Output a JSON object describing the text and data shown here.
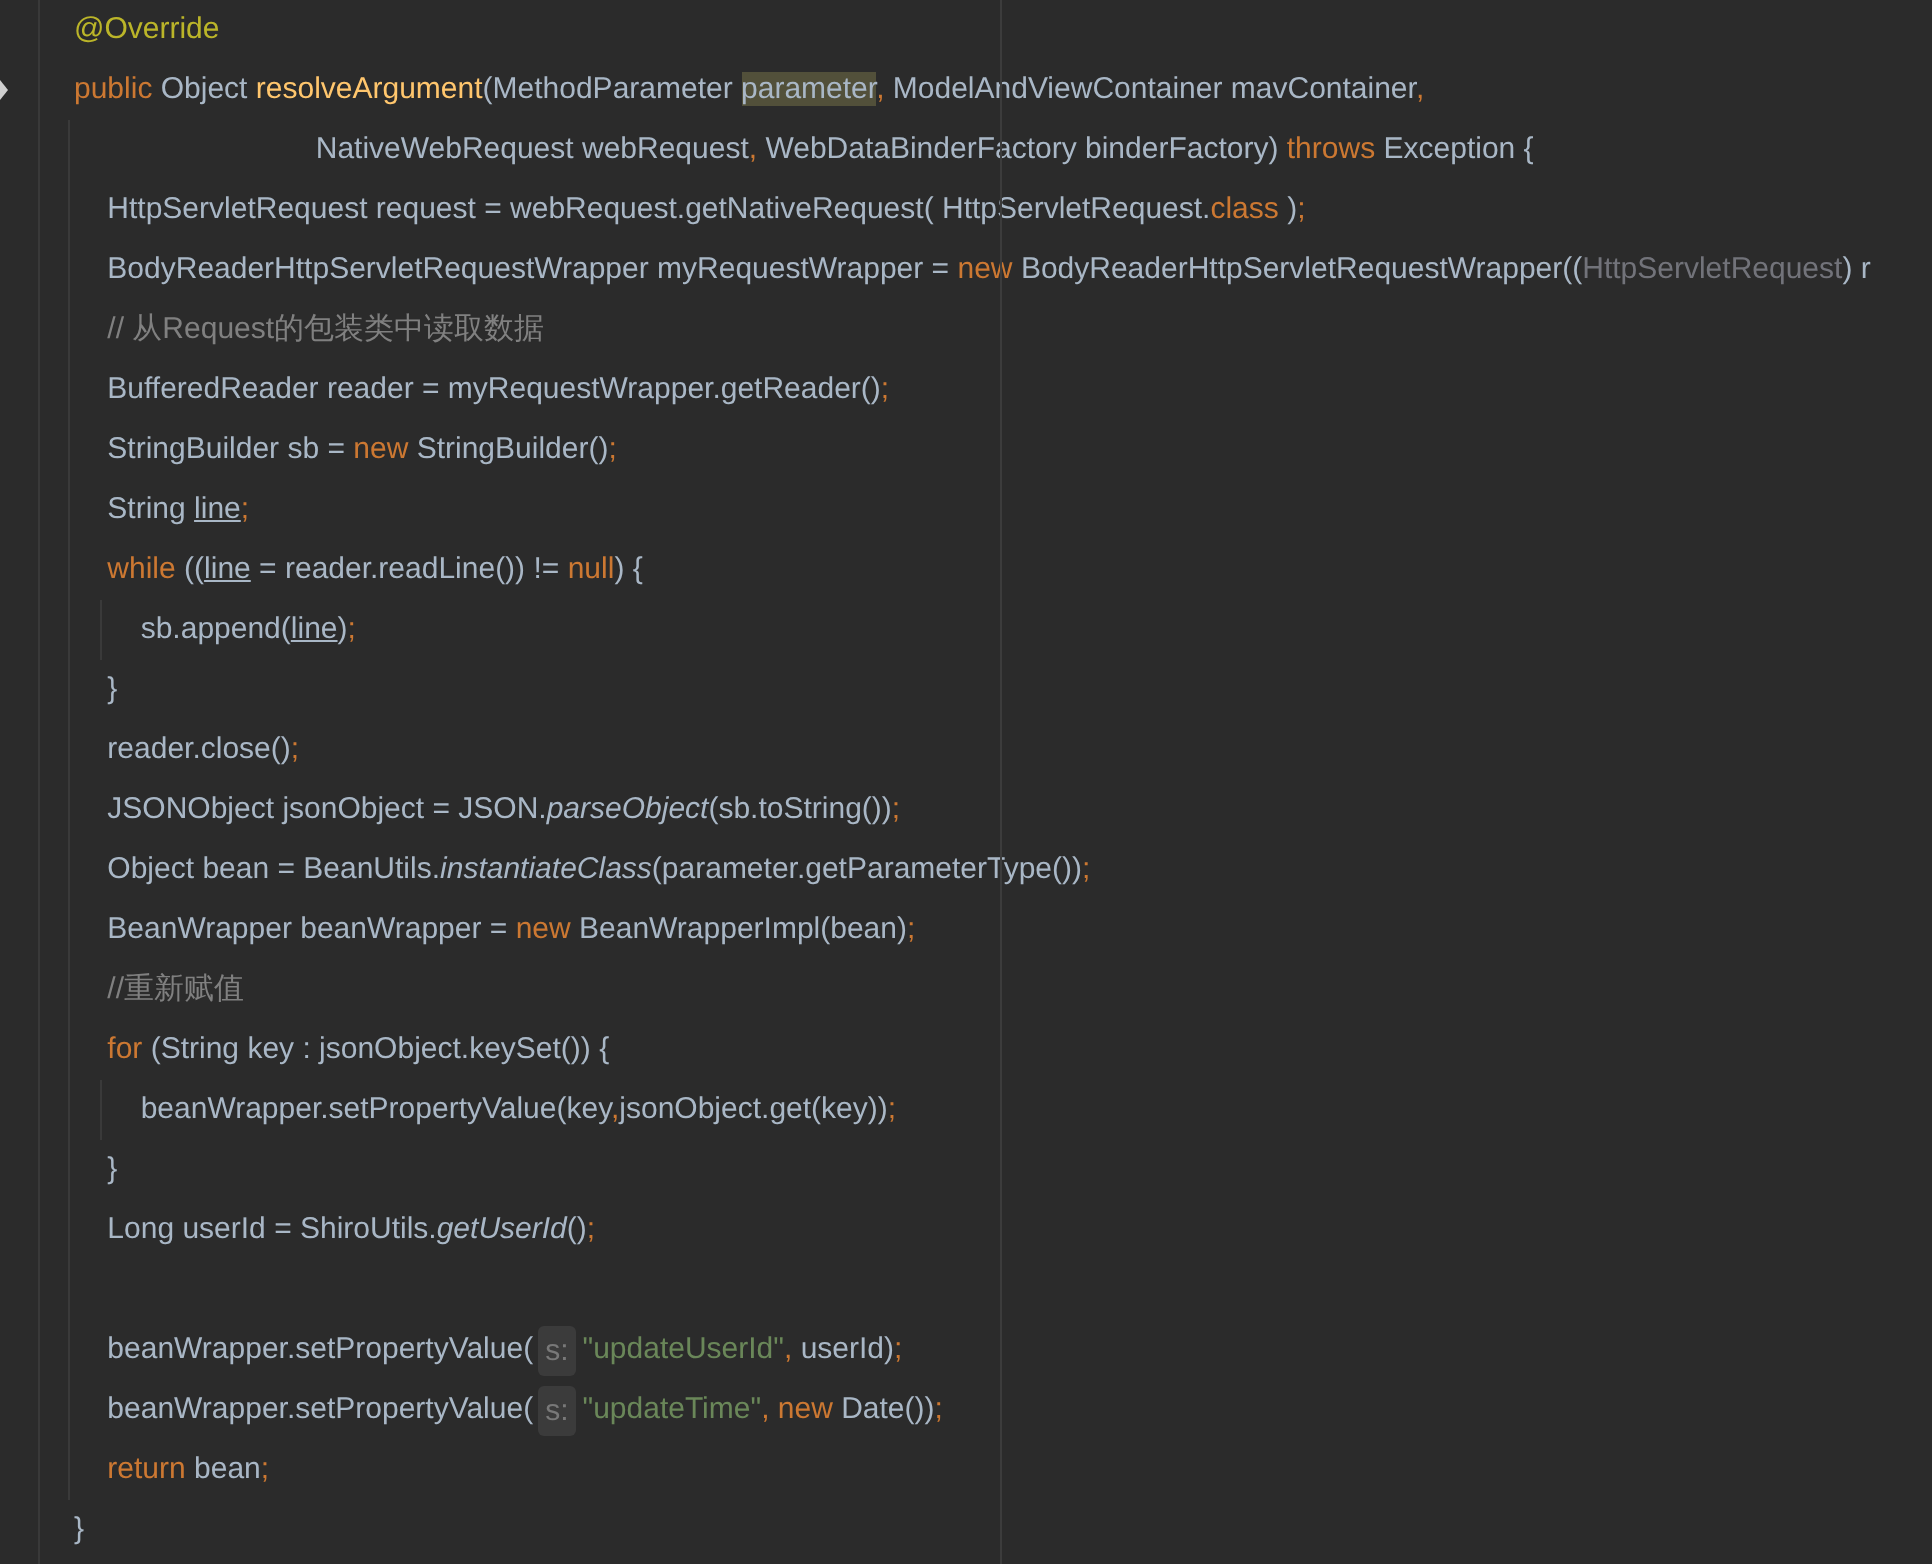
{
  "editor": {
    "lines": [
      [
        {
          "kind": "annotation",
          "text": "@Override"
        }
      ],
      [
        {
          "kind": "keyword",
          "text": "public "
        },
        {
          "kind": "plain",
          "text": "Object "
        },
        {
          "kind": "declaration",
          "text": "resolveArgument"
        },
        {
          "kind": "plain",
          "text": "(MethodParameter "
        },
        {
          "kind": "usage",
          "text": "parameter"
        },
        {
          "kind": "keyword",
          "text": ", "
        },
        {
          "kind": "plain",
          "text": "ModelAndViewContainer mavContainer"
        },
        {
          "kind": "keyword",
          "text": ","
        }
      ],
      [
        {
          "kind": "plain",
          "text": "                             NativeWebRequest webRequest"
        },
        {
          "kind": "keyword",
          "text": ", "
        },
        {
          "kind": "plain",
          "text": "WebDataBinderFactory binderFactory) "
        },
        {
          "kind": "keyword",
          "text": "throws "
        },
        {
          "kind": "plain",
          "text": "Exception {"
        }
      ],
      [
        {
          "kind": "plain",
          "text": "    HttpServletRequest request = webRequest.getNativeRequest( HttpServletRequest."
        },
        {
          "kind": "keyword",
          "text": "class "
        },
        {
          "kind": "plain",
          "text": ")"
        },
        {
          "kind": "keyword",
          "text": ";"
        }
      ],
      [
        {
          "kind": "plain",
          "text": "    BodyReaderHttpServletRequestWrapper myRequestWrapper = "
        },
        {
          "kind": "keyword",
          "text": "new "
        },
        {
          "kind": "plain",
          "text": "BodyReaderHttpServletRequestWrapper(("
        },
        {
          "kind": "unused",
          "text": "HttpServletRequest"
        },
        {
          "kind": "plain",
          "text": ") r"
        }
      ],
      [
        {
          "kind": "comment",
          "text": "    // 从Request的包装类中读取数据"
        }
      ],
      [
        {
          "kind": "plain",
          "text": "    BufferedReader reader = myRequestWrapper.getReader()"
        },
        {
          "kind": "keyword",
          "text": ";"
        }
      ],
      [
        {
          "kind": "plain",
          "text": "    StringBuilder sb = "
        },
        {
          "kind": "keyword",
          "text": "new "
        },
        {
          "kind": "plain",
          "text": "StringBuilder()"
        },
        {
          "kind": "keyword",
          "text": ";"
        }
      ],
      [
        {
          "kind": "plain",
          "text": "    String "
        },
        {
          "kind": "reassigned",
          "text": "line"
        },
        {
          "kind": "keyword",
          "text": ";"
        }
      ],
      [
        {
          "kind": "keyword",
          "text": "    while "
        },
        {
          "kind": "plain",
          "text": "(("
        },
        {
          "kind": "reassigned",
          "text": "line"
        },
        {
          "kind": "plain",
          "text": " = reader.readLine()) != "
        },
        {
          "kind": "keyword",
          "text": "null"
        },
        {
          "kind": "plain",
          "text": ") {"
        }
      ],
      [
        {
          "kind": "plain",
          "text": "        sb.append("
        },
        {
          "kind": "reassigned",
          "text": "line"
        },
        {
          "kind": "plain",
          "text": ")"
        },
        {
          "kind": "keyword",
          "text": ";"
        }
      ],
      [
        {
          "kind": "plain",
          "text": "    }"
        }
      ],
      [
        {
          "kind": "plain",
          "text": "    reader.close()"
        },
        {
          "kind": "keyword",
          "text": ";"
        }
      ],
      [
        {
          "kind": "plain",
          "text": "    JSONObject jsonObject = JSON."
        },
        {
          "kind": "static",
          "text": "parseObject"
        },
        {
          "kind": "plain",
          "text": "(sb.toString())"
        },
        {
          "kind": "keyword",
          "text": ";"
        }
      ],
      [
        {
          "kind": "plain",
          "text": "    Object bean = BeanUtils."
        },
        {
          "kind": "static",
          "text": "instantiateClass"
        },
        {
          "kind": "plain",
          "text": "(parameter.getParameterType())"
        },
        {
          "kind": "keyword",
          "text": ";"
        }
      ],
      [
        {
          "kind": "plain",
          "text": "    BeanWrapper beanWrapper = "
        },
        {
          "kind": "keyword",
          "text": "new "
        },
        {
          "kind": "plain",
          "text": "BeanWrapperImpl(bean)"
        },
        {
          "kind": "keyword",
          "text": ";"
        }
      ],
      [
        {
          "kind": "comment",
          "text": "    //重新赋值"
        }
      ],
      [
        {
          "kind": "keyword",
          "text": "    for "
        },
        {
          "kind": "plain",
          "text": "(String key : jsonObject.keySet()) {"
        }
      ],
      [
        {
          "kind": "plain",
          "text": "        beanWrapper.setPropertyValue(key"
        },
        {
          "kind": "keyword",
          "text": ","
        },
        {
          "kind": "plain",
          "text": "jsonObject.get(key))"
        },
        {
          "kind": "keyword",
          "text": ";"
        }
      ],
      [
        {
          "kind": "plain",
          "text": "    }"
        }
      ],
      [
        {
          "kind": "plain",
          "text": "    Long userId = ShiroUtils."
        },
        {
          "kind": "static",
          "text": "getUserId"
        },
        {
          "kind": "plain",
          "text": "()"
        },
        {
          "kind": "keyword",
          "text": ";"
        }
      ],
      {
        "kind": "blank"
      },
      [
        {
          "kind": "plain",
          "text": "    beanWrapper.setPropertyValue("
        },
        {
          "kind": "hint",
          "text": "s:"
        },
        {
          "kind": "string",
          "text": "\"updateUserId\""
        },
        {
          "kind": "keyword",
          "text": ", "
        },
        {
          "kind": "plain",
          "text": "userId)"
        },
        {
          "kind": "keyword",
          "text": ";"
        }
      ],
      [
        {
          "kind": "plain",
          "text": "    beanWrapper.setPropertyValue("
        },
        {
          "kind": "hint",
          "text": "s:"
        },
        {
          "kind": "string",
          "text": "\"updateTime\""
        },
        {
          "kind": "keyword",
          "text": ", new "
        },
        {
          "kind": "plain",
          "text": "Date())"
        },
        {
          "kind": "keyword",
          "text": ";"
        }
      ],
      [
        {
          "kind": "keyword",
          "text": "    return "
        },
        {
          "kind": "plain",
          "text": "bean"
        },
        {
          "kind": "keyword",
          "text": ";"
        }
      ],
      [
        {
          "kind": "plain",
          "text": "}"
        }
      ]
    ]
  }
}
